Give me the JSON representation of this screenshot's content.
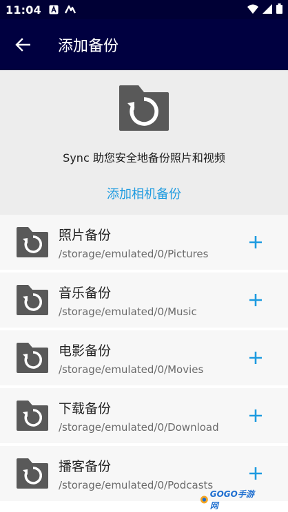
{
  "status_bar": {
    "time": "11:04",
    "icons_left": [
      "a-notification-icon",
      "tasker-icon"
    ],
    "icons_right": [
      "wifi-icon",
      "signal-icon",
      "battery-icon"
    ]
  },
  "app_bar": {
    "title": "添加备份",
    "background": "#000040"
  },
  "hero": {
    "description": "Sync 助您安全地备份照片和视频",
    "action_label": "添加相机备份",
    "accent": "#1e9be0"
  },
  "folders": [
    {
      "name": "照片备份",
      "path": "/storage/emulated/0/Pictures"
    },
    {
      "name": "音乐备份",
      "path": "/storage/emulated/0/Music"
    },
    {
      "name": "电影备份",
      "path": "/storage/emulated/0/Movies"
    },
    {
      "name": "下载备份",
      "path": "/storage/emulated/0/Download"
    },
    {
      "name": "播客备份",
      "path": "/storage/emulated/0/Podcasts"
    }
  ],
  "watermark": {
    "text": "GOGO手游网"
  }
}
